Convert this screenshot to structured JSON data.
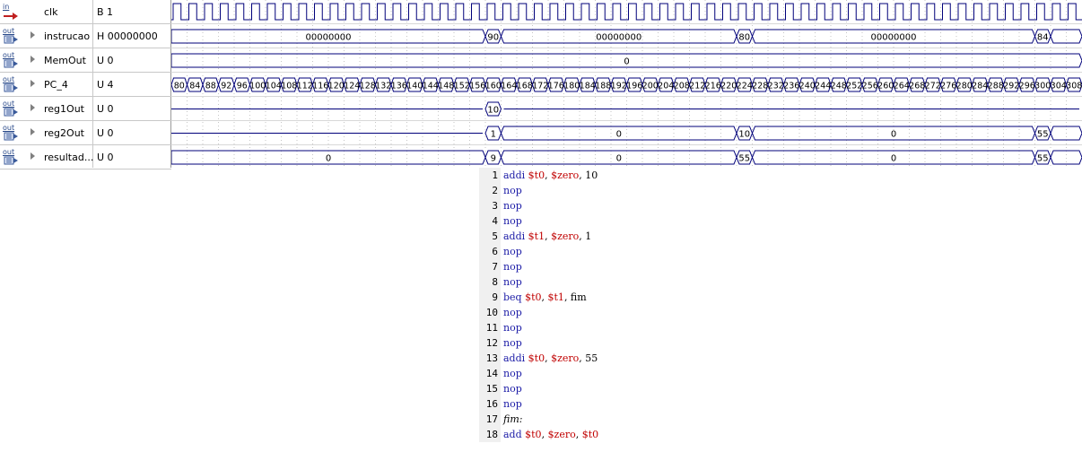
{
  "signals": [
    {
      "io": "in",
      "name": "clk",
      "value": "B 1",
      "expandable": false
    },
    {
      "io": "out",
      "name": "instrucao",
      "value": "H 00000000",
      "expandable": true
    },
    {
      "io": "out",
      "name": "MemOut",
      "value": "U 0",
      "expandable": true
    },
    {
      "io": "out",
      "name": "PC_4",
      "value": "U 4",
      "expandable": true
    },
    {
      "io": "out",
      "name": "reg1Out",
      "value": "U 0",
      "expandable": true
    },
    {
      "io": "out",
      "name": "reg2Out",
      "value": "U 0",
      "expandable": true
    },
    {
      "io": "out",
      "name": "resultad...",
      "value": "U 0",
      "expandable": true
    }
  ],
  "waveforms": {
    "clk": {
      "type": "clock",
      "cycles": 58
    },
    "instrucao": {
      "type": "bus",
      "segments": [
        {
          "label": "00000000",
          "t0": 0,
          "t1": 20
        },
        {
          "label": "90",
          "t0": 20,
          "t1": 21
        },
        {
          "label": "00000000",
          "t0": 21,
          "t1": 36
        },
        {
          "label": "80",
          "t0": 36,
          "t1": 37
        },
        {
          "label": "00000000",
          "t0": 37,
          "t1": 55
        },
        {
          "label": "84",
          "t0": 55,
          "t1": 56
        },
        {
          "label": "",
          "t0": 56,
          "t1": 58
        }
      ]
    },
    "MemOut": {
      "type": "bus",
      "segments": [
        {
          "label": "0",
          "t0": 0,
          "t1": 58
        }
      ]
    },
    "PC_4": {
      "type": "bus_counter",
      "start": 80,
      "step": 4,
      "count": 58
    },
    "reg1Out": {
      "type": "bus",
      "segments": [
        {
          "label": "",
          "t0": 0,
          "t1": 20,
          "flat": true
        },
        {
          "label": "10",
          "t0": 20,
          "t1": 21
        },
        {
          "label": "",
          "t0": 21,
          "t1": 58,
          "flat": true
        }
      ]
    },
    "reg2Out": {
      "type": "bus",
      "segments": [
        {
          "label": "",
          "t0": 0,
          "t1": 20,
          "flat": true
        },
        {
          "label": "1",
          "t0": 20,
          "t1": 21
        },
        {
          "label": "0",
          "t0": 21,
          "t1": 36
        },
        {
          "label": "10",
          "t0": 36,
          "t1": 37
        },
        {
          "label": "0",
          "t0": 37,
          "t1": 55
        },
        {
          "label": "55",
          "t0": 55,
          "t1": 56
        },
        {
          "label": "",
          "t0": 56,
          "t1": 58
        }
      ]
    },
    "resultado": {
      "type": "bus",
      "segments": [
        {
          "label": "0",
          "t0": 0,
          "t1": 20
        },
        {
          "label": "9",
          "t0": 20,
          "t1": 21
        },
        {
          "label": "0",
          "t0": 21,
          "t1": 36
        },
        {
          "label": "55",
          "t0": 36,
          "t1": 37
        },
        {
          "label": "0",
          "t0": 37,
          "t1": 55
        },
        {
          "label": "55",
          "t0": 55,
          "t1": 56
        },
        {
          "label": "",
          "t0": 56,
          "t1": 58
        }
      ]
    }
  },
  "colors": {
    "wave_line": "#00007a",
    "grid_dot": "#a0a0a0",
    "wave_text": "#000000"
  },
  "code": {
    "lines": [
      {
        "n": "1",
        "tokens": [
          [
            "kw",
            "addi "
          ],
          [
            "reg",
            "$t0"
          ],
          [
            "plain",
            ", "
          ],
          [
            "reg",
            "$zero"
          ],
          [
            "plain",
            ", 10"
          ]
        ]
      },
      {
        "n": "2",
        "tokens": [
          [
            "kw",
            "nop"
          ]
        ]
      },
      {
        "n": "3",
        "tokens": [
          [
            "kw",
            "nop"
          ]
        ]
      },
      {
        "n": "4",
        "tokens": [
          [
            "kw",
            "nop"
          ]
        ]
      },
      {
        "n": "5",
        "tokens": [
          [
            "kw",
            "addi "
          ],
          [
            "reg",
            "$t1"
          ],
          [
            "plain",
            ", "
          ],
          [
            "reg",
            "$zero"
          ],
          [
            "plain",
            ", 1"
          ]
        ]
      },
      {
        "n": "6",
        "tokens": [
          [
            "kw",
            "nop"
          ]
        ]
      },
      {
        "n": "7",
        "tokens": [
          [
            "kw",
            "nop"
          ]
        ]
      },
      {
        "n": "8",
        "tokens": [
          [
            "kw",
            "nop"
          ]
        ]
      },
      {
        "n": "9",
        "tokens": [
          [
            "kw",
            "beq "
          ],
          [
            "reg",
            "$t0"
          ],
          [
            "plain",
            ", "
          ],
          [
            "reg",
            "$t1"
          ],
          [
            "plain",
            ", fim"
          ]
        ]
      },
      {
        "n": "10",
        "tokens": [
          [
            "kw",
            "nop"
          ]
        ]
      },
      {
        "n": "11",
        "tokens": [
          [
            "kw",
            "nop"
          ]
        ]
      },
      {
        "n": "12",
        "tokens": [
          [
            "kw",
            "nop"
          ]
        ]
      },
      {
        "n": "13",
        "tokens": [
          [
            "kw",
            "addi "
          ],
          [
            "reg",
            "$t0"
          ],
          [
            "plain",
            ", "
          ],
          [
            "reg",
            "$zero"
          ],
          [
            "plain",
            ", 55"
          ]
        ]
      },
      {
        "n": "14",
        "tokens": [
          [
            "kw",
            "nop"
          ]
        ]
      },
      {
        "n": "15",
        "tokens": [
          [
            "kw",
            "nop"
          ]
        ]
      },
      {
        "n": "16",
        "tokens": [
          [
            "kw",
            "nop"
          ]
        ]
      },
      {
        "n": "17",
        "tokens": [
          [
            "label",
            "fim:"
          ]
        ]
      },
      {
        "n": "18",
        "tokens": [
          [
            "kw",
            "add "
          ],
          [
            "reg",
            "$t0"
          ],
          [
            "plain",
            ", "
          ],
          [
            "reg",
            "$zero"
          ],
          [
            "plain",
            ", "
          ],
          [
            "reg",
            "$t0"
          ]
        ]
      }
    ]
  }
}
